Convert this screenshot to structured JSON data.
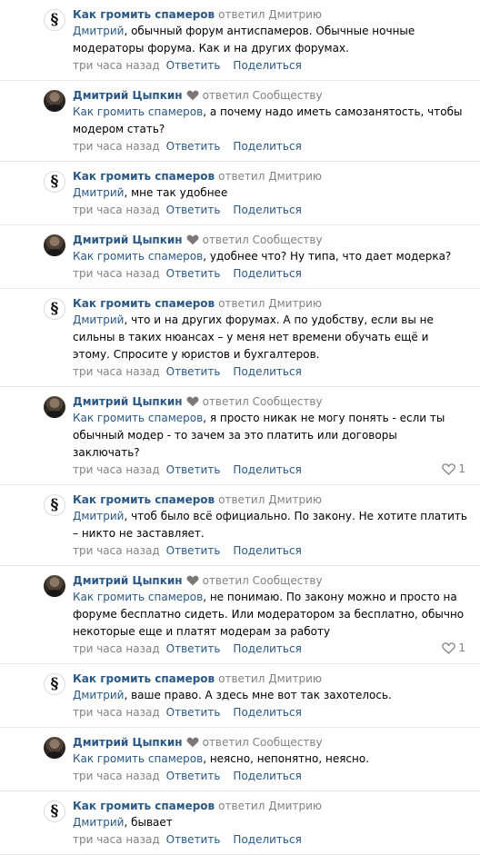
{
  "comments": [
    {
      "author": "Как громить спамеров",
      "avatar": "paragraph-icon",
      "badge": false,
      "replied_prefix": "ответил",
      "replied_to": "Дмитрию",
      "mention": "Дмитрий",
      "body": ", обычный форум антиспамеров. Обычные ночные модераторы форума. Как и на других форумах.",
      "time": "три часа назад",
      "reply_label": "Ответить",
      "share_label": "Поделиться",
      "likes": ""
    },
    {
      "author": "Дмитрий Цыпкин",
      "avatar": "user-photo",
      "badge": true,
      "replied_prefix": "ответил",
      "replied_to": "Сообществу",
      "mention": "Как громить спамеров",
      "body": ", а почему надо иметь самозанятость, чтобы модером стать?",
      "time": "три часа назад",
      "reply_label": "Ответить",
      "share_label": "Поделиться",
      "likes": ""
    },
    {
      "author": "Как громить спамеров",
      "avatar": "paragraph-icon",
      "badge": false,
      "replied_prefix": "ответил",
      "replied_to": "Дмитрию",
      "mention": "Дмитрий",
      "body": ", мне так удобнее",
      "time": "три часа назад",
      "reply_label": "Ответить",
      "share_label": "Поделиться",
      "likes": ""
    },
    {
      "author": "Дмитрий Цыпкин",
      "avatar": "user-photo",
      "badge": true,
      "replied_prefix": "ответил",
      "replied_to": "Сообществу",
      "mention": "Как громить спамеров",
      "body": ", удобнее что? Ну типа, что дает модерка?",
      "time": "три часа назад",
      "reply_label": "Ответить",
      "share_label": "Поделиться",
      "likes": ""
    },
    {
      "author": "Как громить спамеров",
      "avatar": "paragraph-icon",
      "badge": false,
      "replied_prefix": "ответил",
      "replied_to": "Дмитрию",
      "mention": "Дмитрий",
      "body": ", что и на других форумах. А по удобству, если вы не сильны в таких нюансах – у меня нет времени обучать ещё и этому. Спросите у юристов и бухгалтеров.",
      "time": "три часа назад",
      "reply_label": "Ответить",
      "share_label": "Поделиться",
      "likes": ""
    },
    {
      "author": "Дмитрий Цыпкин",
      "avatar": "user-photo",
      "badge": true,
      "replied_prefix": "ответил",
      "replied_to": "Сообществу",
      "mention": "Как громить спамеров",
      "body": ", я просто никак не могу понять - если ты обычный модер - то зачем за это платить или договоры заключать?",
      "time": "три часа назад",
      "reply_label": "Ответить",
      "share_label": "Поделиться",
      "likes": "1"
    },
    {
      "author": "Как громить спамеров",
      "avatar": "paragraph-icon",
      "badge": false,
      "replied_prefix": "ответил",
      "replied_to": "Дмитрию",
      "mention": "Дмитрий",
      "body": ", чтоб было всё официально. По закону. Не хотите платить – никто не заставляет.",
      "time": "три часа назад",
      "reply_label": "Ответить",
      "share_label": "Поделиться",
      "likes": ""
    },
    {
      "author": "Дмитрий Цыпкин",
      "avatar": "user-photo",
      "badge": true,
      "replied_prefix": "ответил",
      "replied_to": "Сообществу",
      "mention": "Как громить спамеров",
      "body": ", не понимаю. По закону можно и просто на форуме бесплатно сидеть. Или модератором за бесплатно, обычно некоторые еще и платят модерам за работу",
      "time": "три часа назад",
      "reply_label": "Ответить",
      "share_label": "Поделиться",
      "likes": "1"
    },
    {
      "author": "Как громить спамеров",
      "avatar": "paragraph-icon",
      "badge": false,
      "replied_prefix": "ответил",
      "replied_to": "Дмитрию",
      "mention": "Дмитрий",
      "body": ", ваше право. А здесь мне вот так захотелось.",
      "time": "три часа назад",
      "reply_label": "Ответить",
      "share_label": "Поделиться",
      "likes": ""
    },
    {
      "author": "Дмитрий Цыпкин",
      "avatar": "user-photo",
      "badge": true,
      "replied_prefix": "ответил",
      "replied_to": "Сообществу",
      "mention": "Как громить спамеров",
      "body": ", неясно, непонятно, неясно.",
      "time": "три часа назад",
      "reply_label": "Ответить",
      "share_label": "Поделиться",
      "likes": ""
    },
    {
      "author": "Как громить спамеров",
      "avatar": "paragraph-icon",
      "badge": false,
      "replied_prefix": "ответил",
      "replied_to": "Дмитрию",
      "mention": "Дмитрий",
      "body": ", бывает",
      "time": "три часа назад",
      "reply_label": "Ответить",
      "share_label": "Поделиться",
      "likes": ""
    }
  ],
  "group_avatar_glyph": "§",
  "colors": {
    "link": "#2a5885",
    "muted": "#828282",
    "divider": "#e7e8ec",
    "badge_heart": "#7d7875"
  }
}
